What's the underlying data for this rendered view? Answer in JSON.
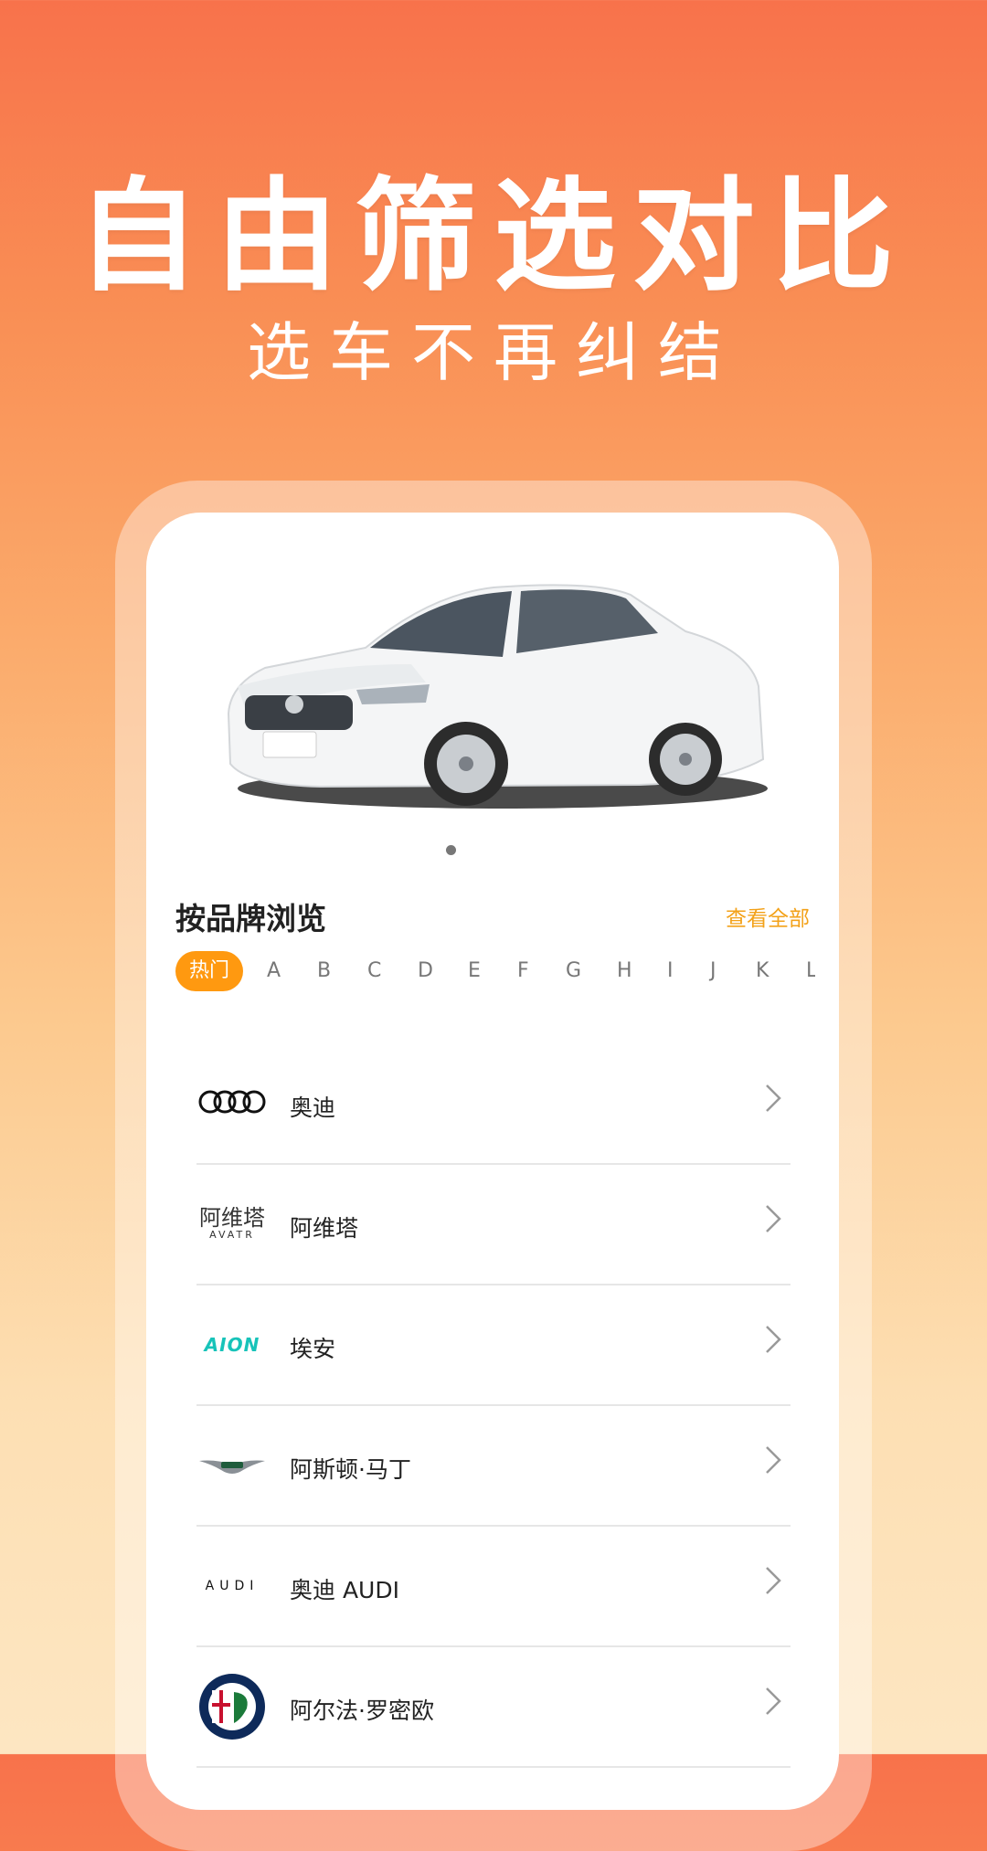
{
  "hero": {
    "title": "自由筛选对比",
    "subtitle": "选车不再纠结"
  },
  "section": {
    "title": "按品牌浏览",
    "view_all": "查看全部"
  },
  "letters": {
    "hot": "热门",
    "items": [
      "A",
      "B",
      "C",
      "D",
      "E",
      "F",
      "G",
      "H",
      "I",
      "J",
      "K",
      "L"
    ]
  },
  "brands": [
    {
      "name": "奥迪",
      "logo": "audi-rings-icon"
    },
    {
      "name": "阿维塔",
      "logo": "avatr-logo",
      "logo_text": "阿维塔",
      "logo_subtext": "AVATR"
    },
    {
      "name": "埃安",
      "logo": "aion-logo",
      "logo_text": "AION"
    },
    {
      "name": "阿斯顿·马丁",
      "logo": "aston-martin-wings-icon"
    },
    {
      "name": "奥迪 AUDI",
      "logo": "audi-wordmark",
      "logo_text": "AUDI"
    },
    {
      "name": "阿尔法·罗密欧",
      "logo": "alfa-romeo-badge-icon"
    }
  ],
  "colors": {
    "accent": "#FF9910",
    "link": "#F3A21A",
    "bg_top": "#F8724B",
    "bg_bottom": "#FDE6C2"
  }
}
